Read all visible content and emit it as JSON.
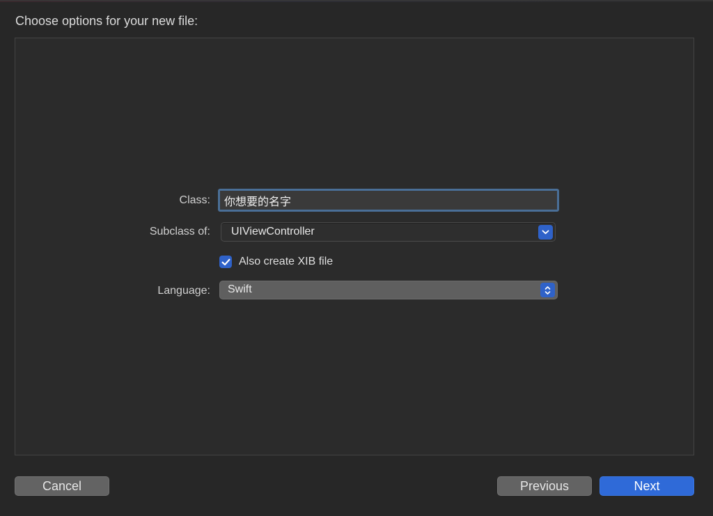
{
  "dialog": {
    "title": "Choose options for your new file:"
  },
  "form": {
    "class_label": "Class:",
    "class_value": "你想要的名字",
    "subclass_label": "Subclass of:",
    "subclass_value": "UIViewController",
    "xib_checkbox_label": "Also create XIB file",
    "xib_checked": true,
    "language_label": "Language:",
    "language_value": "Swift"
  },
  "buttons": {
    "cancel": "Cancel",
    "previous": "Previous",
    "next": "Next"
  },
  "colors": {
    "accent": "#2f62c9",
    "background": "#272727"
  },
  "icons": {
    "subclass_dropdown": "chevron-down-icon",
    "language_popup": "updown-chevron-icon",
    "checkbox": "checkmark-icon"
  }
}
